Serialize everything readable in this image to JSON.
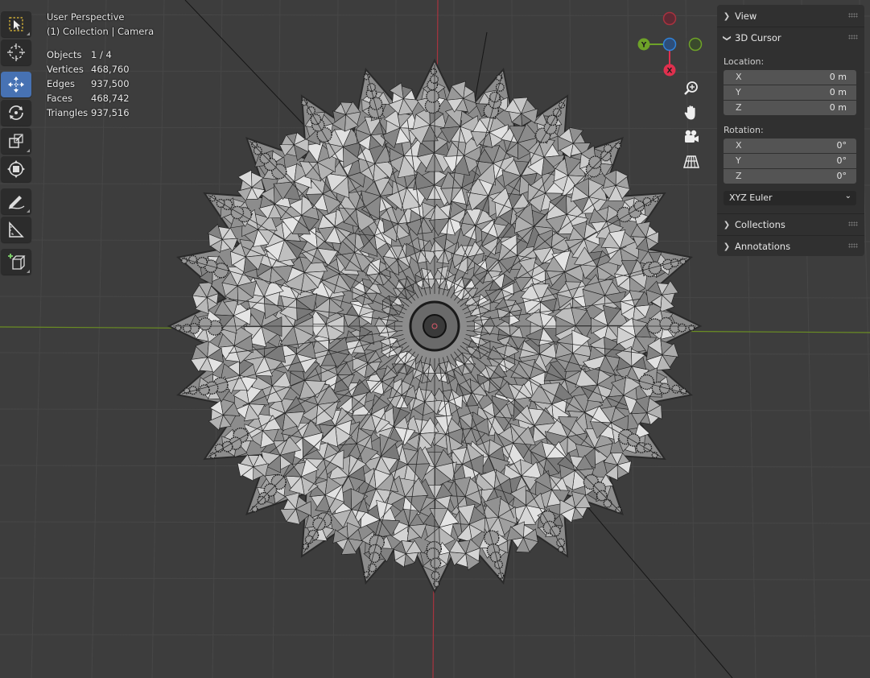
{
  "viewport": {
    "title": "User Perspective",
    "subtitle": "(1) Collection | Camera",
    "stats": [
      {
        "label": "Objects",
        "value": "1 / 4"
      },
      {
        "label": "Vertices",
        "value": "468,760"
      },
      {
        "label": "Edges",
        "value": "937,500"
      },
      {
        "label": "Faces",
        "value": "468,742"
      },
      {
        "label": "Triangles",
        "value": "937,516"
      }
    ]
  },
  "toolbar": {
    "tools": [
      {
        "name": "select-box-tool",
        "icon": "select-box-icon",
        "active": false
      },
      {
        "name": "cursor-tool",
        "icon": "cursor-icon",
        "active": false
      },
      {
        "name": "move-tool",
        "icon": "move-icon",
        "active": true
      },
      {
        "name": "rotate-tool",
        "icon": "rotate-icon",
        "active": false
      },
      {
        "name": "scale-tool",
        "icon": "scale-icon",
        "active": false
      },
      {
        "name": "transform-tool",
        "icon": "transform-icon",
        "active": false
      },
      {
        "name": "annotate-tool",
        "icon": "annotate-icon",
        "active": false
      },
      {
        "name": "measure-tool",
        "icon": "measure-icon",
        "active": false
      },
      {
        "name": "add-cube-tool",
        "icon": "add-cube-icon",
        "active": false
      }
    ]
  },
  "gizmo": {
    "axes": {
      "x": "X",
      "y": "Y",
      "z": "Z"
    },
    "colors": {
      "x": "#e0304e",
      "y": "#6ea228",
      "z": "#2f82d9"
    }
  },
  "sidebar": {
    "view_label": "View",
    "cursor_label": "3D Cursor",
    "location_label": "Location:",
    "location": [
      {
        "axis": "X",
        "value": "0 m"
      },
      {
        "axis": "Y",
        "value": "0 m"
      },
      {
        "axis": "Z",
        "value": "0 m"
      }
    ],
    "rotation_label": "Rotation:",
    "rotation": [
      {
        "axis": "X",
        "value": "0°"
      },
      {
        "axis": "Y",
        "value": "0°"
      },
      {
        "axis": "Z",
        "value": "0°"
      }
    ],
    "rotation_mode": "XYZ Euler",
    "collections_label": "Collections",
    "annotations_label": "Annotations"
  },
  "colors": {
    "background": "#3d3d3d",
    "panel": "#303030",
    "active_tool": "#4772b3",
    "x_axis_line": "#a8343f",
    "y_axis_line": "#6b8e23"
  }
}
